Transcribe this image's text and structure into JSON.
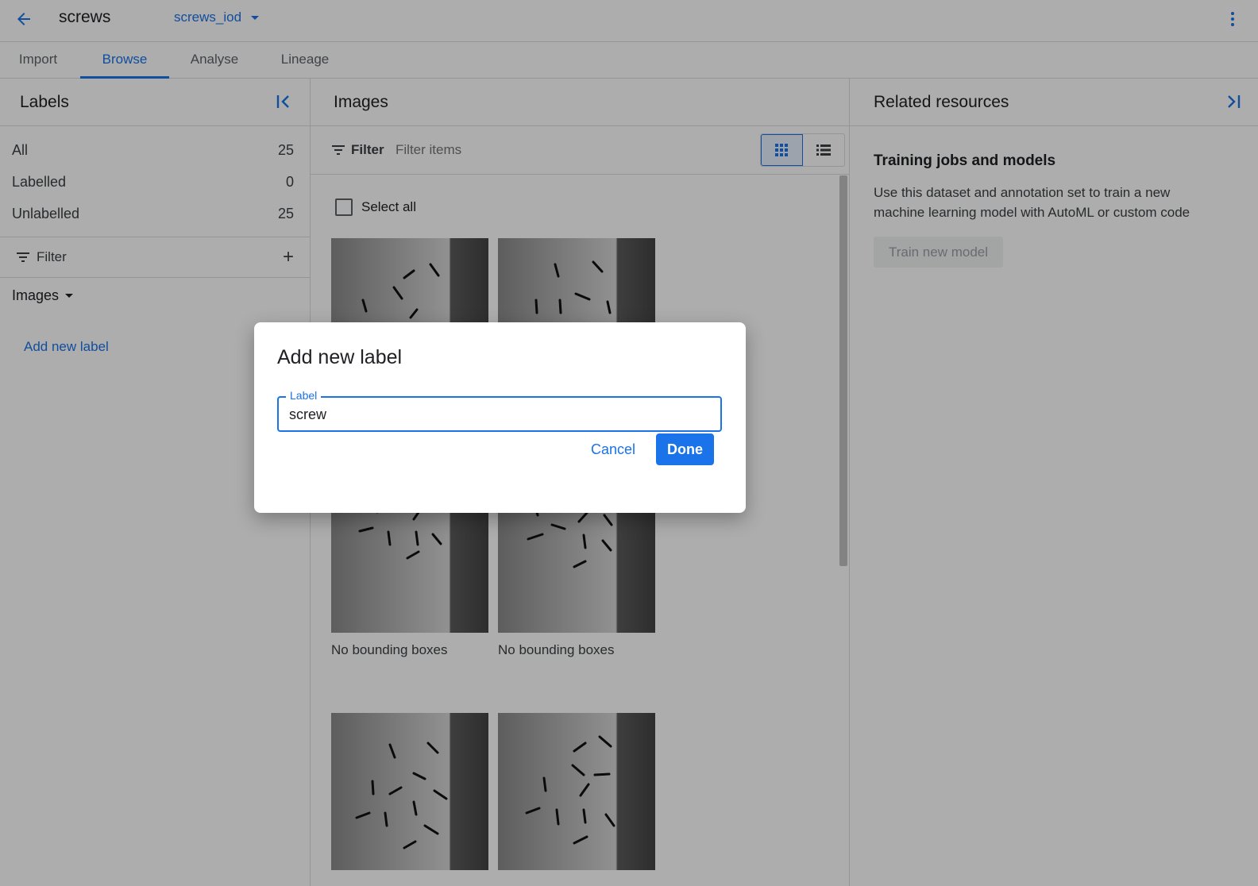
{
  "topbar": {
    "back_icon": "arrow-back-icon",
    "dataset_title": "screws",
    "annotation_set": "screws_iod",
    "more_icon": "more-vert-icon"
  },
  "tabs": [
    {
      "label": "Import",
      "active": false
    },
    {
      "label": "Browse",
      "active": true
    },
    {
      "label": "Analyse",
      "active": false
    },
    {
      "label": "Lineage",
      "active": false
    }
  ],
  "labels_panel": {
    "title": "Labels",
    "counts": [
      {
        "label": "All",
        "count": "25"
      },
      {
        "label": "Labelled",
        "count": "0"
      },
      {
        "label": "Unlabelled",
        "count": "25"
      }
    ],
    "filter_label": "Filter",
    "images_dropdown": "Images",
    "add_new_label": "Add new label"
  },
  "images_panel": {
    "title": "Images",
    "filter_label": "Filter",
    "filter_placeholder": "Filter items",
    "select_all": "Select all",
    "thumbnails": [
      {
        "caption": ""
      },
      {
        "caption": ""
      },
      {
        "caption": "No bounding boxes"
      },
      {
        "caption": "No bounding boxes"
      },
      {
        "caption": ""
      },
      {
        "caption": ""
      }
    ]
  },
  "related_panel": {
    "title": "Related resources",
    "section_title": "Training jobs and models",
    "description": "Use this dataset and annotation set to train a new machine learning model with AutoML or custom code",
    "train_button": "Train new model"
  },
  "dialog": {
    "title": "Add new label",
    "field_label": "Label",
    "field_value": "screw",
    "cancel": "Cancel",
    "done": "Done"
  },
  "colors": {
    "accent": "#1a73e8",
    "text": "#202124",
    "divider": "#dadce0"
  }
}
